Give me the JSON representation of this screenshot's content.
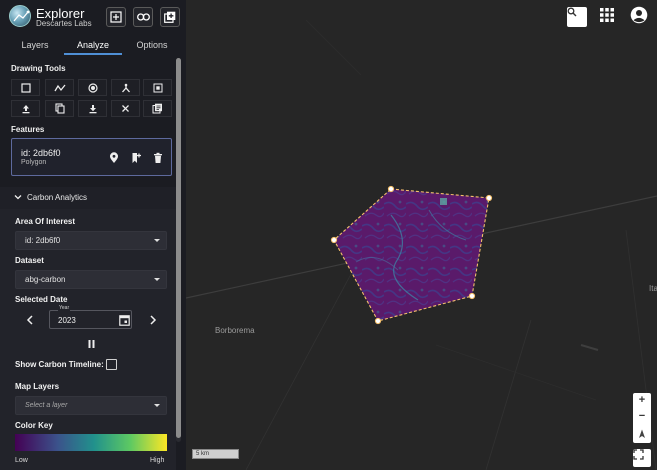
{
  "app": {
    "title": "Explorer",
    "subtitle": "Descartes Labs"
  },
  "header_buttons": [
    {
      "icon": "add-bookmark-icon"
    },
    {
      "icon": "link-icon"
    },
    {
      "icon": "add-layer-icon"
    }
  ],
  "tabs": [
    {
      "label": "Layers",
      "active": false
    },
    {
      "label": "Analyze",
      "active": true
    },
    {
      "label": "Options",
      "active": false
    }
  ],
  "drawing_tools": {
    "label": "Drawing Tools",
    "row1": [
      "draw-rectangle-icon",
      "draw-polyline-icon",
      "draw-circle-icon",
      "draw-point-icon",
      "select-shape-icon"
    ],
    "row2": [
      "upload-icon",
      "copy-icon",
      "download-icon",
      "clear-icon",
      "list-icon"
    ]
  },
  "features": {
    "label": "Features",
    "items": [
      {
        "id": "id: 2db6f0",
        "type": "Polygon"
      }
    ]
  },
  "carbon": {
    "heading": "Carbon Analytics",
    "aoi_label": "Area Of Interest",
    "aoi_value": "id: 2db6f0",
    "dataset_label": "Dataset",
    "dataset_value": "abg-carbon",
    "date_label": "Selected Date",
    "year_label": "Year",
    "year_value": "2023",
    "timeline_label": "Show Carbon Timeline:",
    "timeline_checked": false,
    "map_layers_label": "Map Layers",
    "map_layers_placeholder": "Select a layer",
    "color_key_label": "Color Key",
    "color_low": "Low",
    "color_high": "High",
    "colormap": [
      "#440154",
      "#3b528b",
      "#21918c",
      "#5ec962",
      "#fde725"
    ]
  },
  "map": {
    "places": [
      "Borborema",
      "Ita"
    ],
    "scale_label": "5 km",
    "polygon_stroke": "#f5c16c",
    "polygon_fill": "#5b1668"
  }
}
